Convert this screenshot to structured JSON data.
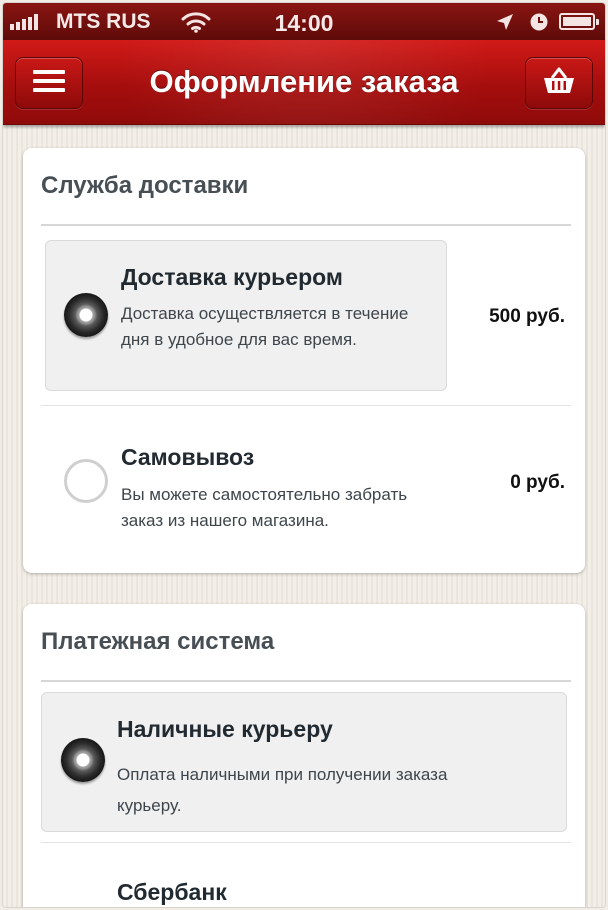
{
  "status_bar": {
    "carrier": "MTS RUS",
    "time": "14:00"
  },
  "nav": {
    "title": "Оформление заказа"
  },
  "delivery": {
    "title": "Служба доставки",
    "options": [
      {
        "title": "Доставка курьером",
        "description": "Доставка осуществляется в течение дня в удобное для вас время.",
        "price": "500 руб.",
        "selected": true
      },
      {
        "title": "Самовывоз",
        "description": "Вы можете самостоятельно забрать заказ из нашего магазина.",
        "price": "0 руб.",
        "selected": false
      }
    ]
  },
  "payment": {
    "title": "Платежная система",
    "options": [
      {
        "title": "Наличные курьеру",
        "description": "Оплата наличными при получении заказа курьеру.",
        "selected": true
      },
      {
        "title": "Сбербанк",
        "selected": false
      }
    ]
  },
  "colors": {
    "nav_red": "#b81312",
    "status_bar": "#6e0f0c",
    "background": "#f1ede6",
    "card": "#ffffff"
  },
  "icons": {
    "menu": "hamburger-icon",
    "basket": "basket-icon",
    "signal": "signal-bars-icon",
    "wifi": "wifi-icon",
    "location": "location-arrow-icon",
    "alarm": "alarm-clock-icon",
    "battery": "battery-icon"
  }
}
